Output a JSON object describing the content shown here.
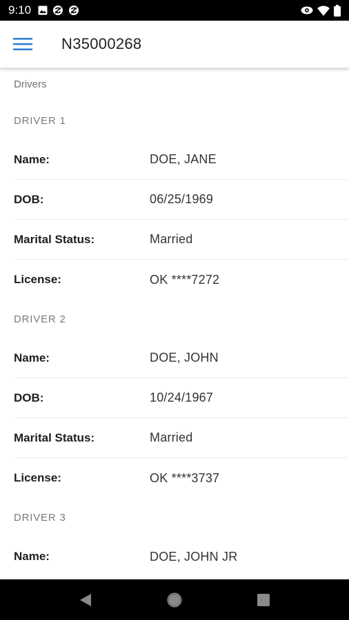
{
  "status_bar": {
    "time": "9:10",
    "left_icons": [
      "image-icon",
      "sync-icon",
      "sync-icon"
    ],
    "right_icons": [
      "eye-icon",
      "wifi-icon",
      "battery-icon"
    ]
  },
  "app_bar": {
    "menu_icon": "hamburger-menu-icon",
    "title": "N35000268",
    "accent_color": "#2f80d1"
  },
  "breadcrumb": "Drivers",
  "drivers": [
    {
      "header": "DRIVER 1",
      "fields": [
        {
          "label": "Name:",
          "value": "DOE, JANE"
        },
        {
          "label": "DOB:",
          "value": "06/25/1969"
        },
        {
          "label": "Marital Status:",
          "value": "Married"
        },
        {
          "label": "License:",
          "value": "OK ****7272"
        }
      ]
    },
    {
      "header": "DRIVER 2",
      "fields": [
        {
          "label": "Name:",
          "value": "DOE, JOHN"
        },
        {
          "label": "DOB:",
          "value": "10/24/1967"
        },
        {
          "label": "Marital Status:",
          "value": "Married"
        },
        {
          "label": "License:",
          "value": "OK ****3737"
        }
      ]
    },
    {
      "header": "DRIVER 3",
      "fields": [
        {
          "label": "Name:",
          "value": "DOE, JOHN JR"
        }
      ]
    }
  ],
  "nav_bar": {
    "buttons": [
      "back-icon",
      "home-icon",
      "recents-icon"
    ]
  }
}
